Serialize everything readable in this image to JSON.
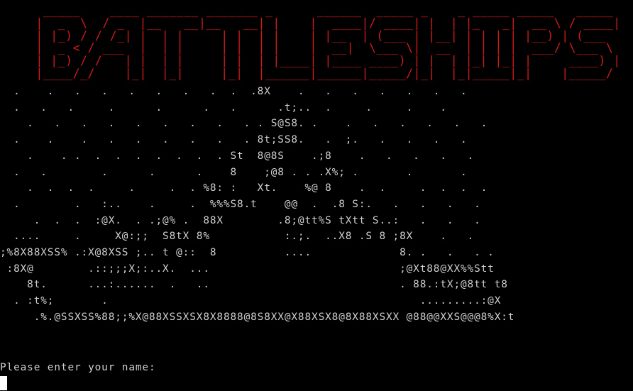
{
  "terminal": {
    "title_art": "  _____    ____ _______ _______ _      ______  _____ _    _ _____ _____   _____ \n |  _  \\  / _  |__   __|__   __| |    |  ____|/ ____| |  | |_   _|  __ \\ / ____|\n | |_) / / /_| |  | |     | |  | |    | |__  | (___ | |__| | | | | |__) | (___  \n |  _ < / ___  |  | |     | |  | |    |  __|  \\___ \\|  __  | | | |  ___/ \\___ \\ \n | |_) / /   | |  | |     | |  | |____| |____ ____) | |  | |_| |_| |     ____) |\n |____/_/    |_|  |_|     |_|  |______|______|_____/|_|  |_|_____|_|    |_____/ ",
    "ship_art": "  .    .   .   .   .   .   .   .  .  .8X    .   .   .   .   .   .   .\n  .   .   .     .      .      .   .      .t;..  .     .     .    .\n    .   .   .   .   .   .   .   .   . . S@S8. .    .   .   .   .   .   .\n  .    .    .   .   .   .   .   .   . 8t;SS8.   .  ;.   .   .   .   .\n    .    . .  .  .  .  .  .  .  . St  8@8S    .;8    .   .   .   .   .\n  .   .        .      .      .    8    ;@8 . . .X%; .       .       .\n    .  .  .  .     .     .  . %8: :   Xt.    %@ 8    .  .     .  .  .  .\n  .        .   :..    .     .  %%%S8.t    @@  .  .8 S:.   .   .   .   .\n     .  .  .  :@X.  . .;@% .  88X        .8;@tt%S tXtt S..:   .   .   .\n  ....     .     X@:;;  S8tX 8%           :.;.  ..X8 .S 8 ;8X    .   .\n;%8X88XSS% .:X@8XSS ;.. t @::  8          ....             8. .   .   . .\n :8X@        .::;;;X;:..X.  ...                            ;@Xt88@XX%%Stt\n    8t.      ...:......  .   ..                            . 88.:tX;@8tt t8\n  . :t%;       .                                              .........:@X\n     .%.@SSXSS%88;;%X@88XSSXSX8X8888@8S8XX@X88XSX8@8X88XSXX @88@@XXS@@@8%X:t",
    "prompt": "Please enter your name:",
    "input_value": ""
  }
}
